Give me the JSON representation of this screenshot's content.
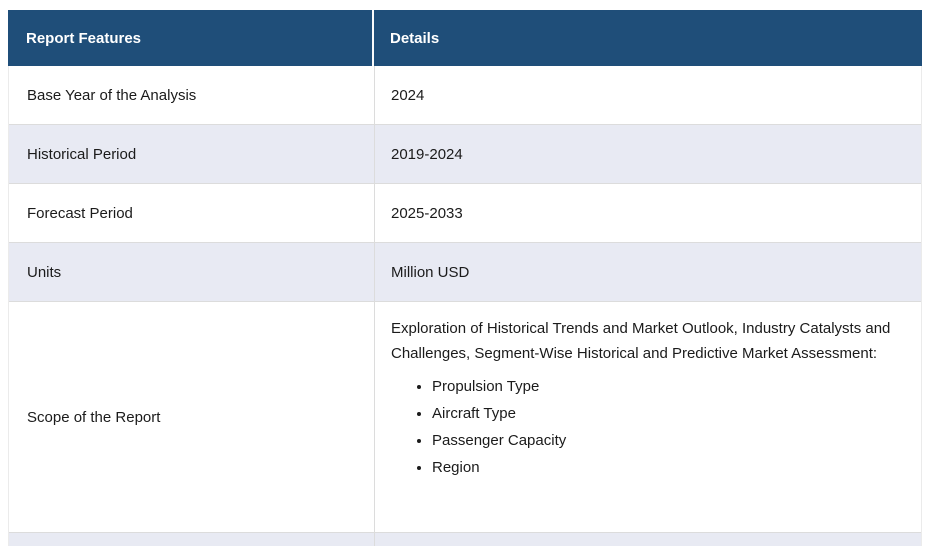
{
  "table": {
    "header": {
      "features": "Report Features",
      "details": "Details"
    },
    "rows": [
      {
        "feature": "Base Year of the Analysis",
        "details": "2024"
      },
      {
        "feature": "Historical Period",
        "details": "2019-2024"
      },
      {
        "feature": "Forecast Period",
        "details": "2025-2033"
      },
      {
        "feature": "Units",
        "details": "Million USD"
      },
      {
        "feature": "Scope of the Report",
        "details_intro": "Exploration of Historical Trends and Market Outlook, Industry Catalysts and Challenges, Segment-Wise Historical and Predictive Market Assessment:",
        "details_bullets": [
          "Propulsion Type",
          "Aircraft Type",
          "Passenger Capacity",
          "Region"
        ]
      }
    ],
    "colors": {
      "header_bg": "#1F4E79",
      "header_text": "#FFFFFF",
      "row_bg": "#FFFFFF",
      "alt_row_bg": "#E8EAF3",
      "border": "#DCDCDC",
      "body_text": "#1B1B1B"
    }
  }
}
